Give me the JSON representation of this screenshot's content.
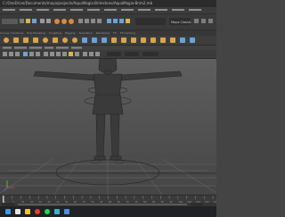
{
  "window": {
    "title": "C:/OneDrive/Documents/maya/projects/AquaMagia-Brimstone/AquaMagia-Brim2.mb"
  },
  "menus": [
    "File",
    "Edit",
    "Create",
    "Select",
    "Modify",
    "Display",
    "Windows",
    "Mesh",
    "Edit Mesh",
    "Mesh Tools",
    "Mesh Display",
    "Curves",
    "Surfaces",
    "Deform",
    "UV",
    "Generate",
    "Cache",
    "Arnold",
    "Help"
  ],
  "workspace": {
    "label": "Maya Classic"
  },
  "shelf": {
    "tabs": [
      "Curves / Surfaces",
      "Poly Modeling",
      "Sculpting",
      "Rigging",
      "Animation",
      "Rendering",
      "FX",
      "FX Caching",
      "Custom",
      "Arnold",
      "Bifrost",
      "MASH",
      "Motion Graphics",
      "XGen"
    ],
    "tools": [
      {
        "icon": "sphere-icon",
        "color": "#d9a64a"
      },
      {
        "icon": "cube-icon",
        "color": "#d9a64a"
      },
      {
        "icon": "cylinder-icon",
        "color": "#d9a64a"
      },
      {
        "icon": "cone-icon",
        "color": "#d9a64a"
      },
      {
        "icon": "torus-icon",
        "color": "#d9a64a"
      },
      {
        "icon": "plane-icon",
        "color": "#d9a64a"
      },
      {
        "icon": "disc-icon",
        "color": "#d9a64a"
      },
      {
        "icon": "sphere-icon",
        "color": "#d9a64a"
      },
      {
        "icon": "combine-icon",
        "color": "#6aa3d8"
      },
      {
        "icon": "separate-icon",
        "color": "#6aa3d8"
      },
      {
        "icon": "smooth-icon",
        "color": "#6aa3d8"
      },
      {
        "icon": "bevel-icon",
        "color": "#d9a64a"
      },
      {
        "icon": "bridge-icon",
        "color": "#d9a64a"
      },
      {
        "icon": "extrude-icon",
        "color": "#d9a64a"
      },
      {
        "icon": "merge-icon",
        "color": "#d9a64a"
      },
      {
        "icon": "multicut-icon",
        "color": "#d9a64a"
      },
      {
        "icon": "target-weld-icon",
        "color": "#d9a64a"
      },
      {
        "icon": "insert-loop-icon",
        "color": "#d9a64a"
      },
      {
        "icon": "mirror-icon",
        "color": "#6aa3d8"
      },
      {
        "icon": "uv-editor-icon",
        "color": "#6aa3d8"
      }
    ]
  },
  "panel": {
    "menus": [
      "View",
      "Shading",
      "Lighting",
      "Show",
      "Renderer",
      "Panels"
    ]
  },
  "timeline": {
    "ticks": [
      "1",
      "5",
      "10",
      "15",
      "20",
      "25",
      "30",
      "35",
      "40",
      "45",
      "50",
      "55",
      "60",
      "65",
      "70",
      "75",
      "80",
      "85",
      "90",
      "95",
      "100",
      "105",
      "110",
      "115",
      "120"
    ]
  },
  "taskbar": {
    "apps": [
      {
        "icon": "windows-start-icon",
        "color": "#3d9ae8"
      },
      {
        "icon": "search-icon",
        "color": "#e6e6e6"
      },
      {
        "icon": "file-explorer-icon",
        "color": "#f2c230"
      },
      {
        "icon": "chrome-icon",
        "color": "#e44134"
      },
      {
        "icon": "spotify-icon",
        "color": "#1ed760"
      },
      {
        "icon": "maya-icon",
        "color": "#37b4c8"
      },
      {
        "icon": "mail-icon",
        "color": "#4b8fe2"
      }
    ]
  }
}
